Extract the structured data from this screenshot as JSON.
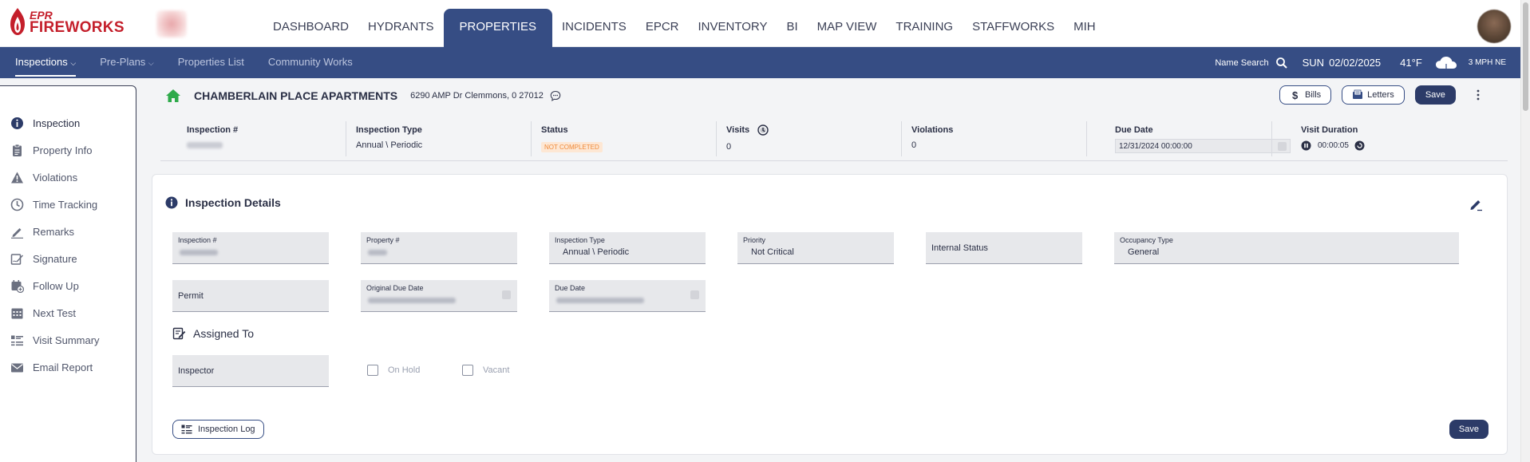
{
  "brand": {
    "line1": "EPR",
    "line2": "FIREWORKS",
    "color": "#c41f2b"
  },
  "main_nav": [
    "DASHBOARD",
    "HYDRANTS",
    "PROPERTIES",
    "INCIDENTS",
    "EPCR",
    "INVENTORY",
    "BI",
    "MAP VIEW",
    "TRAINING",
    "STAFFWORKS",
    "MIH"
  ],
  "main_nav_active": "PROPERTIES",
  "sub_nav": {
    "items": [
      "Inspections",
      "Pre-Plans",
      "Properties List",
      "Community Works"
    ],
    "active": "Inspections",
    "name_search": "Name Search",
    "day": "SUN",
    "date": "02/02/2025",
    "temperature": "41°F",
    "wind": "3 MPH NE"
  },
  "sidebar": [
    "Inspection",
    "Property Info",
    "Violations",
    "Time Tracking",
    "Remarks",
    "Signature",
    "Follow Up",
    "Next Test",
    "Visit Summary",
    "Email Report"
  ],
  "property": {
    "name": "CHAMBERLAIN PLACE APARTMENTS",
    "address": "6290 AMP Dr Clemmons, 0 27012",
    "bills_label": "Bills",
    "letters_label": "Letters",
    "save_label": "Save"
  },
  "summary": {
    "inspection_num_label": "Inspection #",
    "inspection_type_label": "Inspection Type",
    "inspection_type_value": "Annual \\ Periodic",
    "status_label": "Status",
    "status_value": "NOT COMPLETED",
    "visits_label": "Visits",
    "visits_value": "0",
    "violations_label": "Violations",
    "violations_value": "0",
    "due_date_label": "Due Date",
    "due_date_value": "12/31/2024 00:00:00",
    "visit_duration_label": "Visit Duration",
    "visit_duration_value": "00:00:05"
  },
  "details": {
    "title": "Inspection Details",
    "inspection_num_label": "Inspection #",
    "property_num_label": "Property #",
    "inspection_type_label": "Inspection Type",
    "inspection_type_value": "Annual \\ Periodic",
    "priority_label": "Priority",
    "priority_value": "Not Critical",
    "internal_status_label": "Internal Status",
    "occupancy_type_label": "Occupancy Type",
    "occupancy_type_value": "General",
    "permit_label": "Permit",
    "original_due_date_label": "Original Due Date",
    "due_date_label": "Due Date",
    "assigned_to_label": "Assigned To",
    "inspector_label": "Inspector",
    "on_hold_label": "On Hold",
    "vacant_label": "Vacant",
    "inspection_log_label": "Inspection Log",
    "save_label": "Save"
  },
  "colors": {
    "primary": "#364d84",
    "button_dark": "#2c3b68",
    "status_orange": "#ef8a3a",
    "home_green": "#2eaa4a"
  }
}
